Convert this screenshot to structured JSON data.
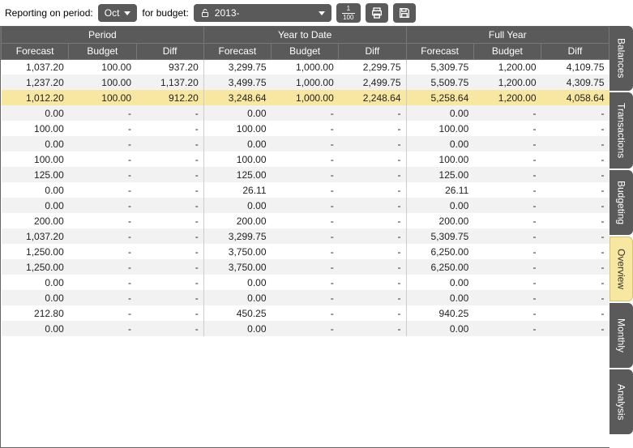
{
  "toolbar": {
    "reporting_label": "Reporting on period:",
    "period_value": "Oct",
    "for_budget_label": "for budget:",
    "budget_value": "2013-",
    "fraction_top": "1",
    "fraction_bottom": "100"
  },
  "headers": {
    "groups": [
      "Period",
      "Year to Date",
      "Full Year"
    ],
    "cols": [
      "Forecast",
      "Budget",
      "Diff"
    ]
  },
  "rows": [
    {
      "hl": false,
      "p": [
        "1,037.20",
        "100.00",
        "937.20"
      ],
      "y": [
        "3,299.75",
        "1,000.00",
        "2,299.75"
      ],
      "f": [
        "5,309.75",
        "1,200.00",
        "4,109.75"
      ]
    },
    {
      "hl": false,
      "p": [
        "1,237.20",
        "100.00",
        "1,137.20"
      ],
      "y": [
        "3,499.75",
        "1,000.00",
        "2,499.75"
      ],
      "f": [
        "5,509.75",
        "1,200.00",
        "4,309.75"
      ]
    },
    {
      "hl": true,
      "p": [
        "1,012.20",
        "100.00",
        "912.20"
      ],
      "y": [
        "3,248.64",
        "1,000.00",
        "2,248.64"
      ],
      "f": [
        "5,258.64",
        "1,200.00",
        "4,058.64"
      ]
    },
    {
      "hl": false,
      "p": [
        "0.00",
        "-",
        "-"
      ],
      "y": [
        "0.00",
        "-",
        "-"
      ],
      "f": [
        "0.00",
        "-",
        "-"
      ]
    },
    {
      "hl": false,
      "p": [
        "100.00",
        "-",
        "-"
      ],
      "y": [
        "100.00",
        "-",
        "-"
      ],
      "f": [
        "100.00",
        "-",
        "-"
      ]
    },
    {
      "hl": false,
      "p": [
        "0.00",
        "-",
        "-"
      ],
      "y": [
        "0.00",
        "-",
        "-"
      ],
      "f": [
        "0.00",
        "-",
        "-"
      ]
    },
    {
      "hl": false,
      "p": [
        "100.00",
        "-",
        "-"
      ],
      "y": [
        "100.00",
        "-",
        "-"
      ],
      "f": [
        "100.00",
        "-",
        "-"
      ]
    },
    {
      "hl": false,
      "p": [
        "125.00",
        "-",
        "-"
      ],
      "y": [
        "125.00",
        "-",
        "-"
      ],
      "f": [
        "125.00",
        "-",
        "-"
      ]
    },
    {
      "hl": false,
      "p": [
        "0.00",
        "-",
        "-"
      ],
      "y": [
        "26.11",
        "-",
        "-"
      ],
      "f": [
        "26.11",
        "-",
        "-"
      ]
    },
    {
      "hl": false,
      "p": [
        "0.00",
        "-",
        "-"
      ],
      "y": [
        "0.00",
        "-",
        "-"
      ],
      "f": [
        "0.00",
        "-",
        "-"
      ]
    },
    {
      "hl": false,
      "p": [
        "200.00",
        "-",
        "-"
      ],
      "y": [
        "200.00",
        "-",
        "-"
      ],
      "f": [
        "200.00",
        "-",
        "-"
      ]
    },
    {
      "hl": false,
      "p": [
        "1,037.20",
        "-",
        "-"
      ],
      "y": [
        "3,299.75",
        "-",
        "-"
      ],
      "f": [
        "5,309.75",
        "-",
        "-"
      ]
    },
    {
      "hl": false,
      "p": [
        "1,250.00",
        "-",
        "-"
      ],
      "y": [
        "3,750.00",
        "-",
        "-"
      ],
      "f": [
        "6,250.00",
        "-",
        "-"
      ]
    },
    {
      "hl": false,
      "p": [
        "1,250.00",
        "-",
        "-"
      ],
      "y": [
        "3,750.00",
        "-",
        "-"
      ],
      "f": [
        "6,250.00",
        "-",
        "-"
      ]
    },
    {
      "hl": false,
      "p": [
        "0.00",
        "-",
        "-"
      ],
      "y": [
        "0.00",
        "-",
        "-"
      ],
      "f": [
        "0.00",
        "-",
        "-"
      ]
    },
    {
      "hl": false,
      "p": [
        "0.00",
        "-",
        "-"
      ],
      "y": [
        "0.00",
        "-",
        "-"
      ],
      "f": [
        "0.00",
        "-",
        "-"
      ]
    },
    {
      "hl": false,
      "p": [
        "212.80",
        "-",
        "-"
      ],
      "y": [
        "450.25",
        "-",
        "-"
      ],
      "f": [
        "940.25",
        "-",
        "-"
      ]
    },
    {
      "hl": false,
      "p": [
        "0.00",
        "-",
        "-"
      ],
      "y": [
        "0.00",
        "-",
        "-"
      ],
      "f": [
        "0.00",
        "-",
        "-"
      ]
    }
  ],
  "tabs": [
    {
      "label": "Balances",
      "active": false
    },
    {
      "label": "Transactions",
      "active": false
    },
    {
      "label": "Budgeting",
      "active": false
    },
    {
      "label": "Overview",
      "active": true
    },
    {
      "label": "Monthly",
      "active": false
    },
    {
      "label": "Analysis",
      "active": false
    }
  ]
}
